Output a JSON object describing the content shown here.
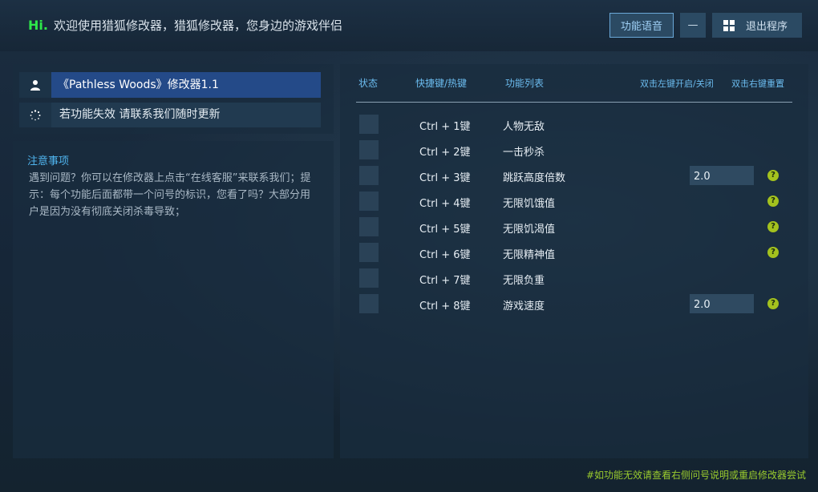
{
  "header": {
    "hi": "Hi.",
    "welcome": "欢迎使用猎狐修改器，猎狐修改器，您身边的游戏伴侣",
    "voice_label": "功能语音",
    "minimize_label": "—",
    "exit_label": "退出程序"
  },
  "sidebar": {
    "game_title": "《Pathless Woods》修改器1.1",
    "update_text": "若功能失效 请联系我们随时更新",
    "note_title": "注意事项",
    "note_body": "遇到问题？你可以在修改器上点击“在线客服”来联系我们；提示：每个功能后面都带一个问号的标识，您看了吗？大部分用户是因为没有彻底关闭杀毒导致；"
  },
  "table": {
    "headers": {
      "status": "状态",
      "hotkey": "快捷键/热键",
      "feature": "功能列表",
      "toggle_hint": "双击左键开启/关闭",
      "reset_hint": "双击右键重置"
    },
    "rows": [
      {
        "hotkey": "Ctrl + 1键",
        "name": "人物无敌"
      },
      {
        "hotkey": "Ctrl + 2键",
        "name": "一击秒杀"
      },
      {
        "hotkey": "Ctrl + 3键",
        "name": "跳跃高度倍数",
        "value": "2.0",
        "help": "?"
      },
      {
        "hotkey": "Ctrl + 4键",
        "name": "无限饥饿值",
        "help": "?"
      },
      {
        "hotkey": "Ctrl + 5键",
        "name": "无限饥渴值",
        "help": "?"
      },
      {
        "hotkey": "Ctrl + 6键",
        "name": "无限精神值",
        "help": "?"
      },
      {
        "hotkey": "Ctrl + 7键",
        "name": "无限负重"
      },
      {
        "hotkey": "Ctrl + 8键",
        "name": "游戏速度",
        "value": "2.0",
        "help": "?"
      }
    ]
  },
  "footer": {
    "note": "#如功能无效请查看右侧问号说明或重启修改器尝试"
  },
  "colors": {
    "accent_green": "#2ee84a",
    "header_text_blue": "#6bbcef",
    "help_badge": "#a4c21e",
    "selected_row": "#244a88"
  },
  "icons": {
    "game": "user-icon",
    "update": "loading-spinner-icon",
    "exit": "windows-logo-icon",
    "help": "question-icon"
  }
}
